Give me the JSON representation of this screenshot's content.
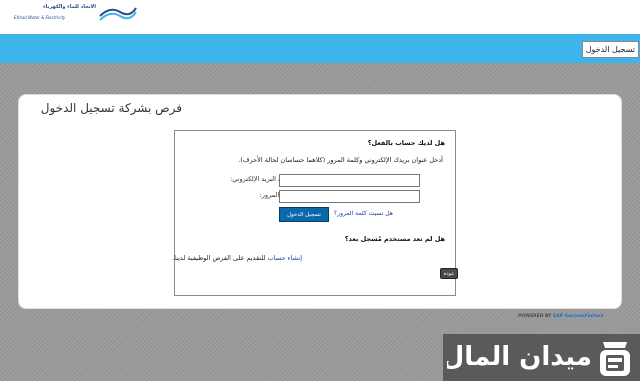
{
  "header": {
    "logo_arabic": "الاتحاد للماء والكهرباء",
    "logo_english": "Etihad Water & Electricity",
    "login_link": "تسجيل الدخول",
    "colors": {
      "bar": "#3db4ea"
    }
  },
  "page": {
    "title": "فرص بشركة تسجيل الدخول"
  },
  "login": {
    "heading": "هل لديك حساب بالفعل؟",
    "instructions": "أدخل عنوان بريدك الإلكتروني وكلمة المرور (كلاهما حساسان لحالة الأحرف).",
    "email_label": "عنوان البريد الإلكتروني:",
    "password_label": "كلمة المرور:",
    "required_marker": "*",
    "email_value": "",
    "password_value": "",
    "signin_button": "تسجيل الدخول",
    "forgot_link": "هل نسيت كلمة المرور؟"
  },
  "register": {
    "heading": "هل لم تعد مستخدم مُسجل بعد؟",
    "create_link": "إنشاء حساب",
    "create_suffix": "للتقديم على الفرص الوظيفية لدينا.",
    "back_button": "عودة"
  },
  "footer": {
    "powered_prefix": "POWERED BY ",
    "powered_brand": "SAP SuccessFactors"
  },
  "watermark": {
    "text": "ميدان المال",
    "icon": "money-bag-icon"
  }
}
